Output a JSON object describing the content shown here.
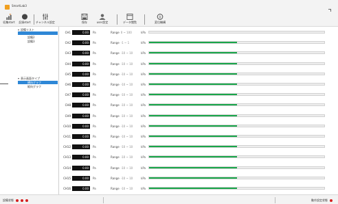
{
  "window": {
    "title": "SmartLab3"
  },
  "toolbar": {
    "buttons": [
      {
        "label": "収集start",
        "icon": "chart-flag-icon"
      },
      {
        "label": "記録start",
        "icon": "record-circle-icon"
      },
      {
        "label": "チャンネル設定",
        "icon": "channel-settings-icon"
      },
      {
        "label": "保存",
        "icon": "save-icon"
      },
      {
        "label": "user設定",
        "icon": "user-icon"
      },
      {
        "label": "データ閲覧",
        "icon": "window-icon"
      },
      {
        "label": "変位機構",
        "icon": "displacement-icon"
      }
    ]
  },
  "sidebar": {
    "group1": {
      "label": "設備リスト",
      "items": [
        "",
        "設備2",
        "設備3"
      ]
    },
    "group2": {
      "label": "表示画面タイプ",
      "items": [
        "横向グラフ",
        "縦向グラフ"
      ]
    }
  },
  "channels": [
    {
      "name": "CH1",
      "value": "0.00",
      "unit": "Pa",
      "range_label": "Range",
      "range": "0 ~ 100",
      "range_unit": "kPa",
      "fill": 0.0
    },
    {
      "name": "CH2",
      "value": "0.00",
      "unit": "Pa",
      "range_label": "Range",
      "range": "-1 ~ 1",
      "range_unit": "kPa",
      "fill": 0.5
    },
    {
      "name": "CH3",
      "value": "0.00",
      "unit": "Pa",
      "range_label": "Range",
      "range": "-10 ~ 10",
      "range_unit": "kPa",
      "fill": 0.5
    },
    {
      "name": "CH4",
      "value": "0.00",
      "unit": "Pa",
      "range_label": "Range",
      "range": "-10 ~ 10",
      "range_unit": "kPa",
      "fill": 0.5
    },
    {
      "name": "CH5",
      "value": "0.00",
      "unit": "Pa",
      "range_label": "Range",
      "range": "-10 ~ 10",
      "range_unit": "kPa",
      "fill": 0.5
    },
    {
      "name": "CH6",
      "value": "0.00",
      "unit": "Pa",
      "range_label": "Range",
      "range": "-10 ~ 10",
      "range_unit": "kPa",
      "fill": 0.5
    },
    {
      "name": "CH7",
      "value": "0.00",
      "unit": "Pa",
      "range_label": "Range",
      "range": "-10 ~ 10",
      "range_unit": "kPa",
      "fill": 0.5
    },
    {
      "name": "CH8",
      "value": "0.00",
      "unit": "Pa",
      "range_label": "Range",
      "range": "-10 ~ 10",
      "range_unit": "kPa",
      "fill": 0.5
    },
    {
      "name": "CH9",
      "value": "0.00",
      "unit": "Pa",
      "range_label": "Range",
      "range": "-10 ~ 10",
      "range_unit": "kPa",
      "fill": 0.5
    },
    {
      "name": "CH10",
      "value": "0.00",
      "unit": "Pa",
      "range_label": "Range",
      "range": "-10 ~ 10",
      "range_unit": "kPa",
      "fill": 0.5
    },
    {
      "name": "CH11",
      "value": "0.00",
      "unit": "Pa",
      "range_label": "Range",
      "range": "-10 ~ 10",
      "range_unit": "kPa",
      "fill": 0.5
    },
    {
      "name": "CH12",
      "value": "0.00",
      "unit": "Pa",
      "range_label": "Range",
      "range": "-10 ~ 10",
      "range_unit": "kPa",
      "fill": 0.5
    },
    {
      "name": "CH13",
      "value": "0.00",
      "unit": "Pa",
      "range_label": "Range",
      "range": "-10 ~ 10",
      "range_unit": "kPa",
      "fill": 0.5
    },
    {
      "name": "CH14",
      "value": "0.00",
      "unit": "Pa",
      "range_label": "Range",
      "range": "-10 ~ 10",
      "range_unit": "kPa",
      "fill": 0.5
    },
    {
      "name": "CH15",
      "value": "0.00",
      "unit": "Pa",
      "range_label": "Range",
      "range": "-10 ~ 10",
      "range_unit": "kPa",
      "fill": 0.5
    },
    {
      "name": "CH16",
      "value": "0.00",
      "unit": "Pa",
      "range_label": "Range",
      "range": "-10 ~ 10",
      "range_unit": "kPa",
      "fill": 0.5
    }
  ],
  "statusbar": {
    "left_label": "設備状態",
    "right_label": "動作設定状態"
  },
  "colors": {
    "bar_fill": "#19a64a",
    "selection": "#2e87d6",
    "status_dot": "#d42020"
  }
}
